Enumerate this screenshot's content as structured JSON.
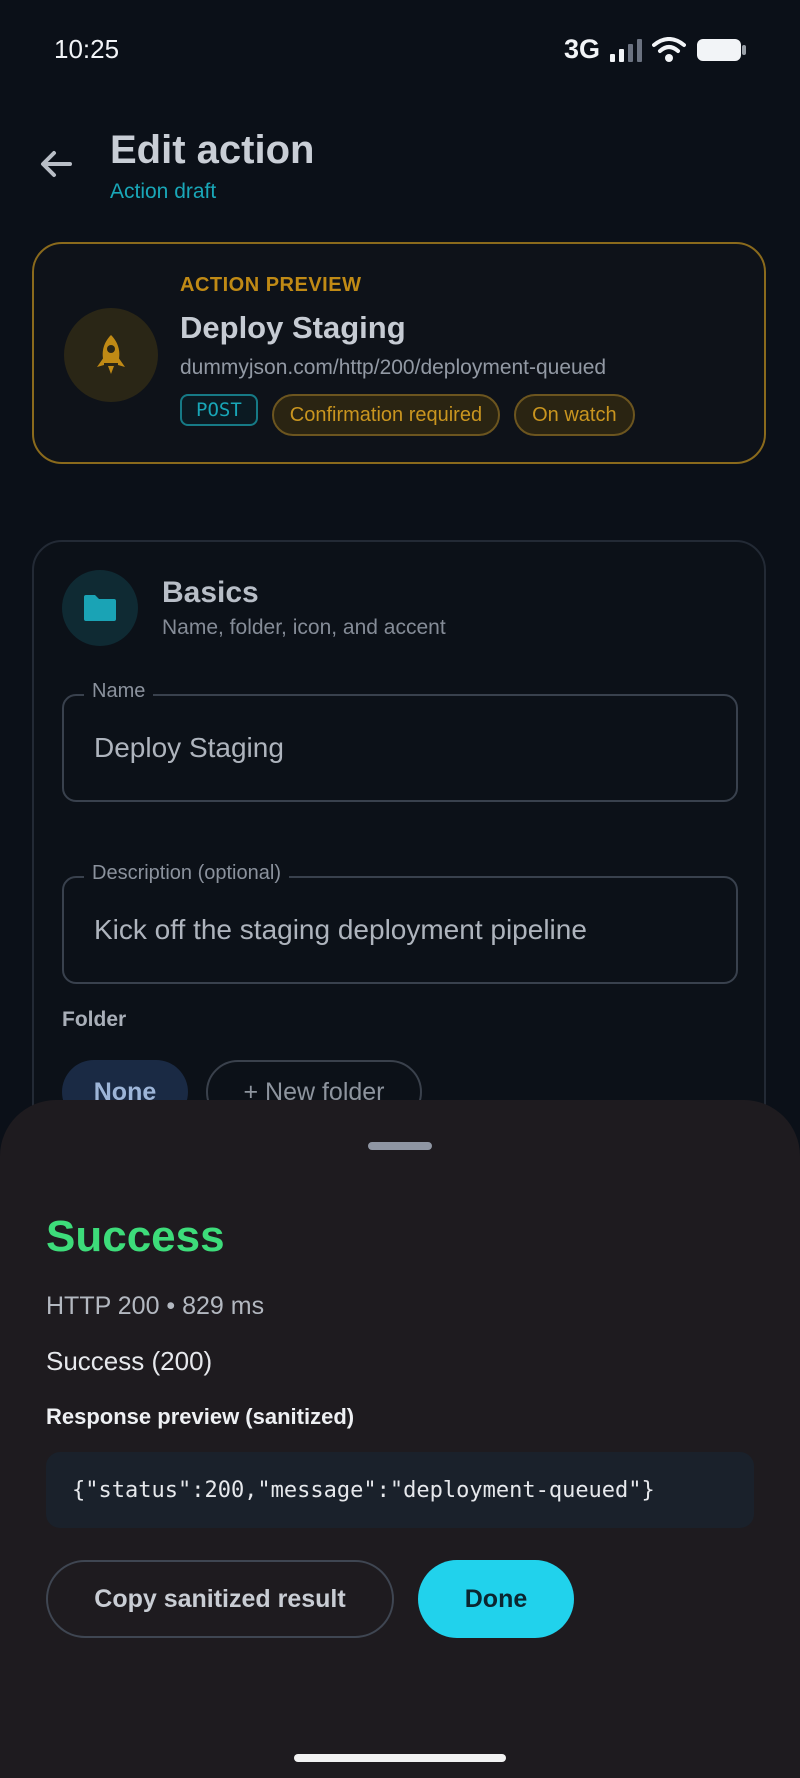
{
  "status_bar": {
    "time": "10:25",
    "network": "3G"
  },
  "header": {
    "title": "Edit action",
    "subtitle": "Action draft"
  },
  "preview": {
    "eyebrow": "ACTION PREVIEW",
    "name": "Deploy Staging",
    "url": "dummyjson.com/http/200/deployment-queued",
    "method": "POST",
    "badges": [
      "Confirmation required",
      "On watch"
    ],
    "accent": "#c08a15",
    "icon": "rocket-icon"
  },
  "basics": {
    "title": "Basics",
    "subtitle": "Name, folder, icon, and accent",
    "icon": "folder-icon",
    "name_label": "Name",
    "name_value": "Deploy Staging",
    "description_label": "Description (optional)",
    "description_value": "Kick off the staging deployment pipeline",
    "folder_label": "Folder",
    "folder_options": [
      "None",
      "+ New folder"
    ]
  },
  "result_sheet": {
    "title": "Success",
    "meta": "HTTP 200 • 829 ms",
    "result_text": "Success (200)",
    "response_label": "Response preview (sanitized)",
    "response_body": "{\"status\":200,\"message\":\"deployment-queued\"}",
    "copy_label": "Copy sanitized result",
    "done_label": "Done",
    "success_color": "#3ddc7a",
    "primary_color": "#21d2ec"
  }
}
